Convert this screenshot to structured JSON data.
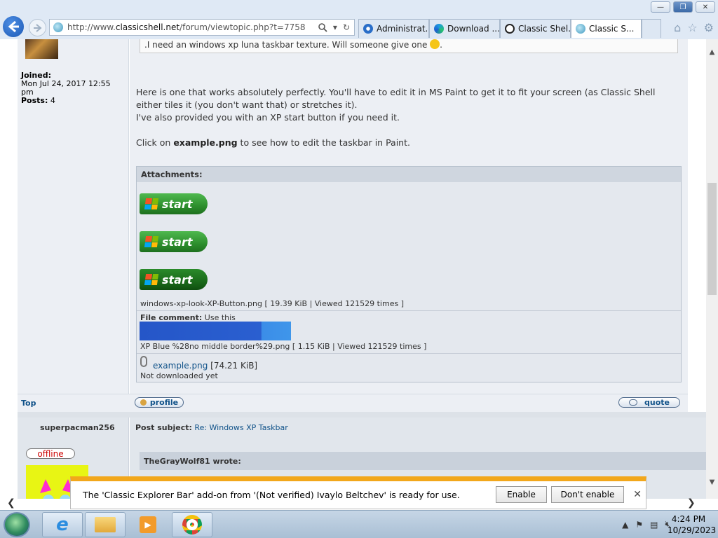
{
  "browser": {
    "url_prefix": "http://www.",
    "url_domain": "classicshell.net",
    "url_path": "/forum/viewtopic.php?t=7758",
    "tabs": [
      {
        "label": "Administrat..."
      },
      {
        "label": "Download ..."
      },
      {
        "label": "Classic Shel..."
      },
      {
        "label": "Classic S..."
      }
    ],
    "window_buttons": {
      "minimize": "—",
      "maximize": "❐",
      "close": "✕"
    }
  },
  "post1": {
    "quote_text": ".I need an windows xp luna taskbar texture. Will someone give one",
    "quote_end": ".",
    "joined_label": "Joined:",
    "joined_value": "Mon Jul 24, 2017 12:55 pm",
    "posts_label": "Posts:",
    "posts_value": "4",
    "body_line1": "Here is one that works absolutely perfectly. You'll have to edit it in MS Paint to get it to fit your screen (as Classic Shell either tiles it (you don't want that) or stretches it).",
    "body_line2": "I've also provided you with an XP start button if you need it.",
    "body_click_pre": "Click on ",
    "body_click_bold": "example.png",
    "body_click_post": " to see how to edit the taskbar in Paint.",
    "attachments_header": "Attachments:",
    "start_label": "start",
    "att1_meta": "windows-xp-look-XP-Button.png [ 19.39 KiB | Viewed 121529 times ]",
    "file_comment_label": "File comment:",
    "file_comment_value": "Use this",
    "att2_meta": "XP Blue %28no middle border%29.png [ 1.15 KiB | Viewed 121529 times ]",
    "att3_name": "example.png",
    "att3_size": "[74.21 KiB]",
    "att3_status": "Not downloaded yet",
    "top_link": "Top",
    "profile_btn": "profile",
    "quote_btn": "quote"
  },
  "post2": {
    "username": "superpacman256",
    "status": "offline",
    "subject_label": "Post subject:",
    "subject_value": "Re: Windows XP Taskbar",
    "wrote": "TheGrayWolf81 wrote:"
  },
  "notification": {
    "message": "The 'Classic Explorer Bar' add-on from '(Not verified) Ivaylo Beltchev' is ready for use.",
    "enable": "Enable",
    "dont_enable": "Don't enable",
    "close": "✕"
  },
  "taskbar": {
    "time": "4:24 PM",
    "date": "10/29/2023"
  },
  "colors": {
    "link": "#105289",
    "accent_orange": "#f2a71b",
    "xp_blue": "#2556c8",
    "start_green": "#2d8f2d"
  }
}
